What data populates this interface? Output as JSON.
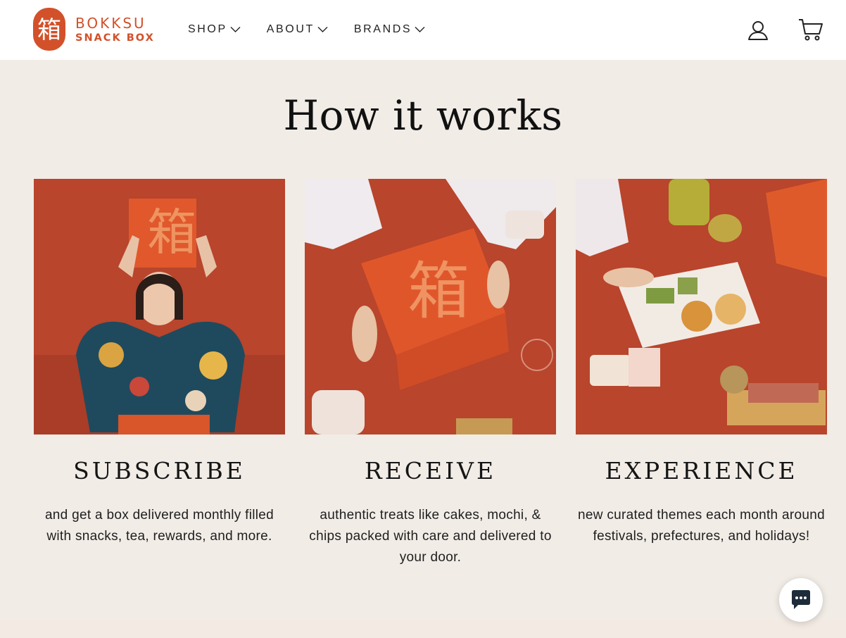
{
  "brand": {
    "logo_glyph": "箱",
    "name_line1": "BOKKSU",
    "name_line2": "SNACK BOX",
    "color": "#d2512a"
  },
  "nav": {
    "items": [
      {
        "label": "SHOP"
      },
      {
        "label": "ABOUT"
      },
      {
        "label": "BRANDS"
      }
    ]
  },
  "header_icons": [
    "account-icon",
    "cart-icon"
  ],
  "section": {
    "title": "How it works"
  },
  "steps": [
    {
      "title": "SUBSCRIBE",
      "text": "and get a box delivered monthly filled with snacks, tea, rewards, and more.",
      "image": "woman holding snack box photo"
    },
    {
      "title": "RECEIVE",
      "text": "authentic treats like cakes, mochi, & chips packed with care and delivered to your door.",
      "image": "hands opening snack box photo"
    },
    {
      "title": "EXPERIENCE",
      "text": "new curated themes each month around festivals, prefectures, and holidays!",
      "image": "snacks and tea spread photo"
    }
  ],
  "chat": {
    "icon": "chat-bubble-icon"
  },
  "colors": {
    "background": "#f1ece6",
    "header": "#ffffff",
    "accent": "#d2512a",
    "photo_red": "#b8452c"
  }
}
